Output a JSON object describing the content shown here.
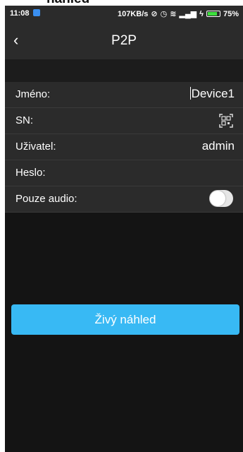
{
  "top_caption": "náhled\"",
  "statusbar": {
    "time": "11:08",
    "network_speed": "107KB/s",
    "battery_percent": "75%"
  },
  "header": {
    "title": "P2P"
  },
  "form": {
    "name_label": "Jméno:",
    "name_value": "Device1",
    "sn_label": "SN:",
    "user_label": "Uživatel:",
    "user_value": "admin",
    "password_label": "Heslo:",
    "audio_label": "Pouze audio:",
    "audio_only": false
  },
  "actions": {
    "live_view_label": "Živý náhled"
  },
  "colors": {
    "accent": "#38b9f4",
    "background": "#141414",
    "row_background": "#2b2b2b"
  }
}
